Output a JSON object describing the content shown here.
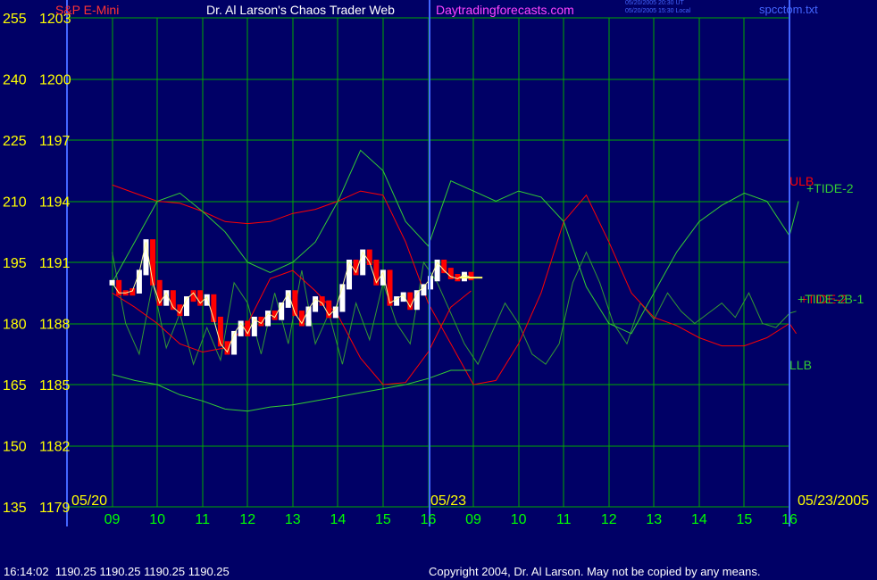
{
  "header": {
    "instrument": "S&P E-Mini",
    "title": "Dr. Al Larson's Chaos Trader Web",
    "site": "Daytradingforecasts.com",
    "time_ut": "05/20/2005 20:30 UT",
    "time_local": "05/20/2005 15:30 Local",
    "filename": "spcctom.txt"
  },
  "footer": {
    "quote": "16:14:02  1190.25 1190.25 1190.25 1190.25",
    "copyright": "Copyright 2004, Dr. Al Larson. May not be copied by any means."
  },
  "colors": {
    "background": "#000066",
    "grid": "#00aa00",
    "axis_label": "#ffff00",
    "x_label": "#00ff00",
    "date_label": "#ffff00",
    "red_band": "#ff0000",
    "green_band": "#33cc33",
    "ticks_white": "#ffffff",
    "ticks_red": "#ff0000",
    "tide_line": "#339933",
    "last_price": "#ffff66",
    "title_text": "#ffffff",
    "site_text": "#ff44ff",
    "file_text": "#4466ff"
  },
  "chart_data": {
    "type": "line",
    "y_left_labels": [
      "255",
      "240",
      "225",
      "210",
      "195",
      "180",
      "165",
      "150",
      "135"
    ],
    "y_right_labels": [
      "1203",
      "1200",
      "1197",
      "1194",
      "1191",
      "1188",
      "1185",
      "1182",
      "1179"
    ],
    "ylim": [
      1179,
      1203
    ],
    "x_labels": [
      "09",
      "10",
      "11",
      "12",
      "13",
      "14",
      "15",
      "16",
      "09",
      "10",
      "11",
      "12",
      "13",
      "14",
      "15",
      "16"
    ],
    "date_labels": [
      "05/20",
      "05/23",
      "05/23/2005"
    ],
    "series_labels": [
      {
        "text": "ULB",
        "color": "#ff0000"
      },
      {
        "text": "+TIDE-2",
        "color": "#33cc33"
      },
      {
        "text": "+TIDE-2",
        "color": "#ff0000"
      },
      {
        "text": "+TIDE-2B-1",
        "color": "#33cc33"
      },
      {
        "text": "LLB",
        "color": "#33cc33"
      }
    ],
    "series": [
      {
        "name": "ULB",
        "color": "#ff0000",
        "x": [
          0,
          0.5,
          1,
          1.5,
          2,
          2.5,
          3,
          3.5,
          4,
          4.5,
          5,
          5.5,
          6,
          6.5,
          7,
          7.5,
          8,
          8.5,
          9,
          9.5,
          10,
          10.5,
          11,
          11.5,
          12,
          12.5,
          13,
          13.5,
          14,
          14.5,
          15,
          15.15
        ],
        "y": [
          1194.8,
          1194.4,
          1194.0,
          1193.9,
          1193.5,
          1193.0,
          1192.9,
          1193.0,
          1193.4,
          1193.6,
          1194.0,
          1194.5,
          1194.3,
          1192.0,
          1189.0,
          1187.0,
          1185.0,
          1185.2,
          1187.0,
          1189.5,
          1193.0,
          1194.3,
          1192.0,
          1189.5,
          1188.3,
          1187.9,
          1187.3,
          1186.9,
          1186.9,
          1187.3,
          1188.0,
          1187.5
        ]
      },
      {
        "name": "LLB",
        "color": "#33cc33",
        "x": [
          0,
          0.5,
          1,
          1.5,
          2,
          2.5,
          3,
          3.5,
          4,
          4.5,
          5,
          5.5,
          6,
          6.5,
          7,
          7.5,
          8,
          8.5,
          9,
          9.5,
          10,
          10.5,
          11,
          11.5,
          12,
          12.5,
          13,
          13.5,
          14,
          14.5,
          15,
          15.2
        ],
        "y": [
          1190.0,
          1192.0,
          1194.0,
          1194.4,
          1193.5,
          1192.5,
          1191.0,
          1190.5,
          1191.0,
          1192.0,
          1194.0,
          1196.5,
          1195.5,
          1193.0,
          1191.8,
          1195.0,
          1194.5,
          1194.0,
          1194.5,
          1194.2,
          1193.0,
          1189.8,
          1188.0,
          1187.5,
          1189.5,
          1191.5,
          1193.0,
          1193.8,
          1194.4,
          1194.0,
          1192.3,
          1194.0
        ]
      },
      {
        "name": "Lower band",
        "color": "#33cc33",
        "x": [
          0,
          0.5,
          1,
          1.5,
          2,
          2.5,
          3,
          3.5,
          4,
          4.5,
          5,
          5.5,
          6,
          6.5,
          7,
          7.5,
          7.95
        ],
        "y": [
          1185.5,
          1185.2,
          1185.0,
          1184.5,
          1184.2,
          1183.8,
          1183.7,
          1183.9,
          1184.0,
          1184.2,
          1184.4,
          1184.6,
          1184.8,
          1185.0,
          1185.3,
          1185.7,
          1185.7
        ]
      },
      {
        "name": "Lower red band",
        "color": "#ff0000",
        "x": [
          0,
          0.5,
          1,
          1.5,
          2,
          2.5,
          3,
          3.5,
          4,
          4.5,
          5,
          5.5,
          6,
          6.5,
          7,
          7.5,
          7.95
        ],
        "y": [
          1189.5,
          1188.8,
          1188.0,
          1187.0,
          1186.6,
          1186.8,
          1188.0,
          1190.2,
          1190.6,
          1189.6,
          1188.4,
          1186.3,
          1185.0,
          1185.1,
          1186.6,
          1188.8,
          1189.6
        ]
      },
      {
        "name": "Last",
        "color": "#ffff66",
        "x": [
          7.7,
          8.2
        ],
        "y": [
          1190.25,
          1190.25
        ]
      }
    ],
    "tide": {
      "name": "+TIDE-2B-1",
      "color": "#339933",
      "x": [
        0,
        0.3,
        0.6,
        0.9,
        1.2,
        1.5,
        1.8,
        2.1,
        2.4,
        2.7,
        3.0,
        3.3,
        3.6,
        3.9,
        4.2,
        4.5,
        4.8,
        5.1,
        5.4,
        5.7,
        6.0,
        6.3,
        6.6,
        6.9,
        7.2,
        7.5,
        7.8,
        8.1,
        8.4,
        8.7,
        9.0,
        9.3,
        9.6,
        9.9,
        10.2,
        10.5,
        10.8,
        11.1,
        11.4,
        11.7,
        12.0,
        12.3,
        12.6,
        12.9,
        13.2,
        13.5,
        13.8,
        14.1,
        14.4,
        14.7,
        15.0,
        15.15
      ],
      "y": [
        1191.5,
        1188.0,
        1186.5,
        1190.0,
        1186.8,
        1188.5,
        1186.0,
        1187.8,
        1186.2,
        1190.0,
        1189.0,
        1186.5,
        1189.5,
        1187.0,
        1190.6,
        1187.0,
        1188.5,
        1186.0,
        1189.0,
        1187.2,
        1190.0,
        1188.0,
        1187.0,
        1191.0,
        1190.0,
        1188.5,
        1187.0,
        1186.0,
        1187.5,
        1189.0,
        1188.0,
        1186.5,
        1186.0,
        1187.0,
        1190.0,
        1191.5,
        1190.0,
        1188.0,
        1187.0,
        1189.0,
        1188.2,
        1189.5,
        1188.6,
        1188.0,
        1188.5,
        1189.0,
        1188.3,
        1189.5,
        1188.0,
        1187.8,
        1188.5,
        1188.6
      ]
    },
    "price": {
      "x": [
        0,
        0.15,
        0.3,
        0.45,
        0.6,
        0.75,
        0.9,
        1.05,
        1.2,
        1.35,
        1.5,
        1.65,
        1.8,
        1.95,
        2.1,
        2.25,
        2.4,
        2.55,
        2.7,
        2.85,
        3.0,
        3.15,
        3.3,
        3.45,
        3.6,
        3.75,
        3.9,
        4.05,
        4.2,
        4.35,
        4.5,
        4.65,
        4.8,
        4.95,
        5.1,
        5.25,
        5.4,
        5.55,
        5.7,
        5.85,
        6.0,
        6.15,
        6.3,
        6.45,
        6.6,
        6.75,
        6.9,
        7.05,
        7.2,
        7.35,
        7.5,
        7.65,
        7.8,
        7.95
      ],
      "y": [
        1190.0,
        1189.5,
        1189.5,
        1189.6,
        1190.5,
        1192.0,
        1190.0,
        1189.0,
        1189.5,
        1188.8,
        1188.5,
        1189.2,
        1189.5,
        1189.0,
        1189.3,
        1188.2,
        1187.0,
        1186.6,
        1187.5,
        1188.0,
        1187.5,
        1188.2,
        1188.0,
        1188.5,
        1188.3,
        1188.9,
        1189.5,
        1188.5,
        1188.0,
        1188.7,
        1189.2,
        1189.0,
        1188.4,
        1188.7,
        1189.8,
        1191.0,
        1190.5,
        1191.5,
        1191.0,
        1190.0,
        1190.5,
        1189.0,
        1189.2,
        1189.4,
        1188.8,
        1189.5,
        1189.8,
        1190.2,
        1191.0,
        1190.6,
        1190.3,
        1190.2,
        1190.4,
        1190.25
      ],
      "dir": [
        0,
        1,
        1,
        1,
        0,
        0,
        1,
        1,
        0,
        1,
        1,
        0,
        1,
        1,
        0,
        1,
        1,
        1,
        0,
        0,
        1,
        0,
        1,
        0,
        1,
        0,
        0,
        1,
        1,
        0,
        0,
        1,
        1,
        0,
        0,
        0,
        1,
        0,
        1,
        1,
        0,
        1,
        0,
        0,
        1,
        0,
        0,
        0,
        0,
        1,
        1,
        1,
        0,
        1
      ]
    }
  }
}
